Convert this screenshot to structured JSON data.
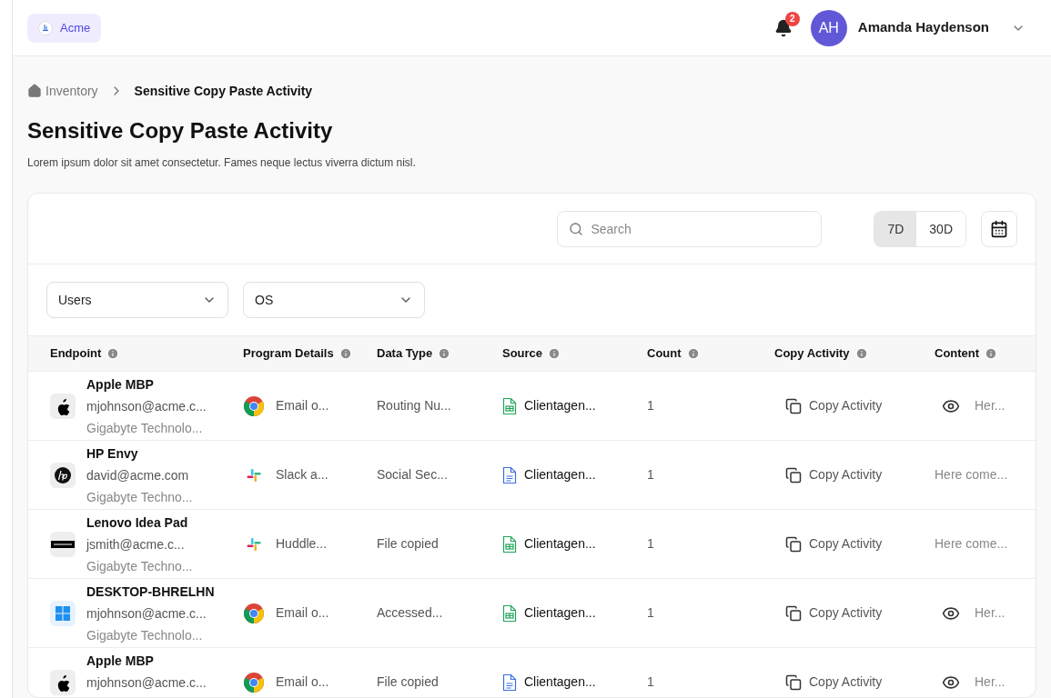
{
  "header": {
    "brand": "Acme",
    "notifications": "2",
    "user": {
      "initials": "AH",
      "name": "Amanda Haydenson"
    }
  },
  "breadcrumb": [
    {
      "label": "Inventory",
      "kind": "home"
    },
    {
      "label": "Sensitive Copy Paste Activity",
      "kind": "current"
    }
  ],
  "title": "Sensitive Copy Paste Activity",
  "subtitle": "Lorem ipsum dolor sit amet consectetur. Fames neque lectus viverra dictum nisl.",
  "search": {
    "placeholder": "Search"
  },
  "ranges": [
    {
      "label": "7D",
      "selected": true
    },
    {
      "label": "30D",
      "selected": false
    }
  ],
  "filters": [
    {
      "label": "Users"
    },
    {
      "label": "OS"
    }
  ],
  "table": {
    "columns": [
      "Endpoint",
      "Program Details",
      "Data Type",
      "Source",
      "Count",
      "Copy Activity",
      "Content"
    ],
    "rows": [
      {
        "endpoint": {
          "kind": "apple",
          "device": "Apple MBP",
          "email": "mjohnson@acme.c...",
          "vendor": "Gigabyte Technolo..."
        },
        "program": {
          "kind": "chrome",
          "text": "Email o..."
        },
        "data_type": "Routing Nu...",
        "source": {
          "kind": "sheet",
          "text": "Clientagen..."
        },
        "count": "1",
        "activity": "Copy Activity",
        "content": {
          "text": "Her...",
          "preview": true
        }
      },
      {
        "endpoint": {
          "kind": "hp",
          "device": "HP Envy",
          "email": "david@acme.com",
          "vendor": "Gigabyte Techno..."
        },
        "program": {
          "kind": "slack",
          "text": "Slack a..."
        },
        "data_type": "Social Sec...",
        "source": {
          "kind": "doc",
          "text": "Clientagen..."
        },
        "count": "1",
        "activity": "Copy Activity",
        "content": {
          "text": "Here come...",
          "preview": false
        }
      },
      {
        "endpoint": {
          "kind": "lenovo",
          "device": "Lenovo Idea Pad",
          "email": "jsmith@acme.c...",
          "vendor": "Gigabyte Techno..."
        },
        "program": {
          "kind": "slack",
          "text": "Huddle..."
        },
        "data_type": "File copied",
        "source": {
          "kind": "sheet",
          "text": "Clientagen..."
        },
        "count": "1",
        "activity": "Copy Activity",
        "content": {
          "text": "Here come...",
          "preview": false
        }
      },
      {
        "endpoint": {
          "kind": "windows",
          "device": "DESKTOP-BHRELHN",
          "email": "mjohnson@acme.c...",
          "vendor": "Gigabyte Technolo..."
        },
        "program": {
          "kind": "chrome",
          "text": "Email o..."
        },
        "data_type": "Accessed...",
        "source": {
          "kind": "sheet",
          "text": "Clientagen..."
        },
        "count": "1",
        "activity": "Copy Activity",
        "content": {
          "text": "Her...",
          "preview": true
        }
      },
      {
        "endpoint": {
          "kind": "apple",
          "device": "Apple MBP",
          "email": "mjohnson@acme.c..."
        },
        "program": {
          "kind": "chrome",
          "text": "Email o..."
        },
        "data_type": "File copied",
        "source": {
          "kind": "doc",
          "text": "Clientagen..."
        },
        "count": "1",
        "activity": "Copy Activity",
        "content": {
          "text": "Her...",
          "preview": true
        }
      }
    ]
  }
}
